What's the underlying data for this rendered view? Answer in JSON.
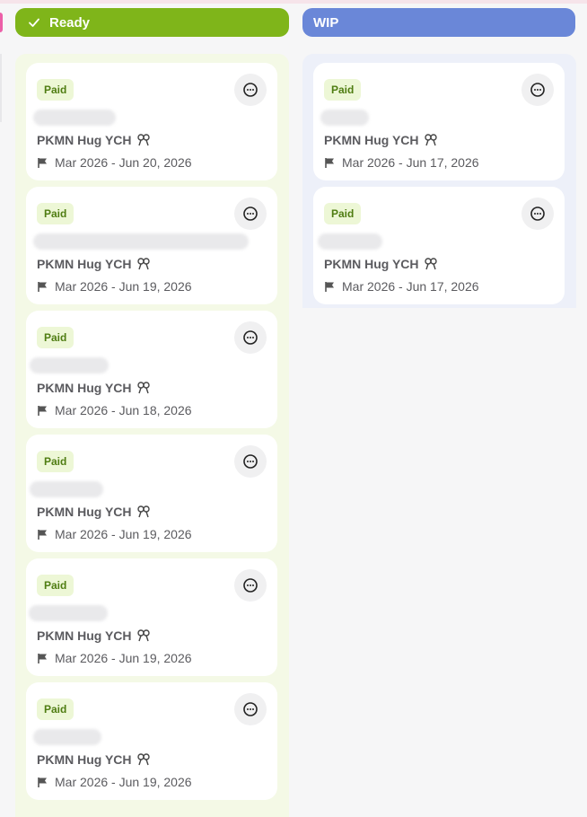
{
  "columns": {
    "ready": {
      "title": "Ready",
      "color": "#7fb51a",
      "icon": "check-icon",
      "cards": [
        {
          "badge": "Paid",
          "title": "PKMN Hug YCH",
          "dates": "Mar 2026 - Jun 20, 2026"
        },
        {
          "badge": "Paid",
          "title": "PKMN Hug YCH",
          "dates": "Mar 2026 - Jun 19, 2026"
        },
        {
          "badge": "Paid",
          "title": "PKMN Hug YCH",
          "dates": "Mar 2026 - Jun 18, 2026"
        },
        {
          "badge": "Paid",
          "title": "PKMN Hug YCH",
          "dates": "Mar 2026 - Jun 19, 2026"
        },
        {
          "badge": "Paid",
          "title": "PKMN Hug YCH",
          "dates": "Mar 2026 - Jun 19, 2026"
        },
        {
          "badge": "Paid",
          "title": "PKMN Hug YCH",
          "dates": "Mar 2026 - Jun 19, 2026"
        }
      ]
    },
    "wip": {
      "title": "WIP",
      "color": "#6a87d8",
      "cards": [
        {
          "badge": "Paid",
          "title": "PKMN Hug YCH",
          "dates": "Mar 2026 - Jun 17, 2026"
        },
        {
          "badge": "Paid",
          "title": "PKMN Hug YCH",
          "dates": "Mar 2026 - Jun 17, 2026"
        }
      ]
    }
  },
  "icons": {
    "comment": "comment-icon",
    "flag": "flag-icon",
    "ribbon": "ribbon-icon"
  }
}
